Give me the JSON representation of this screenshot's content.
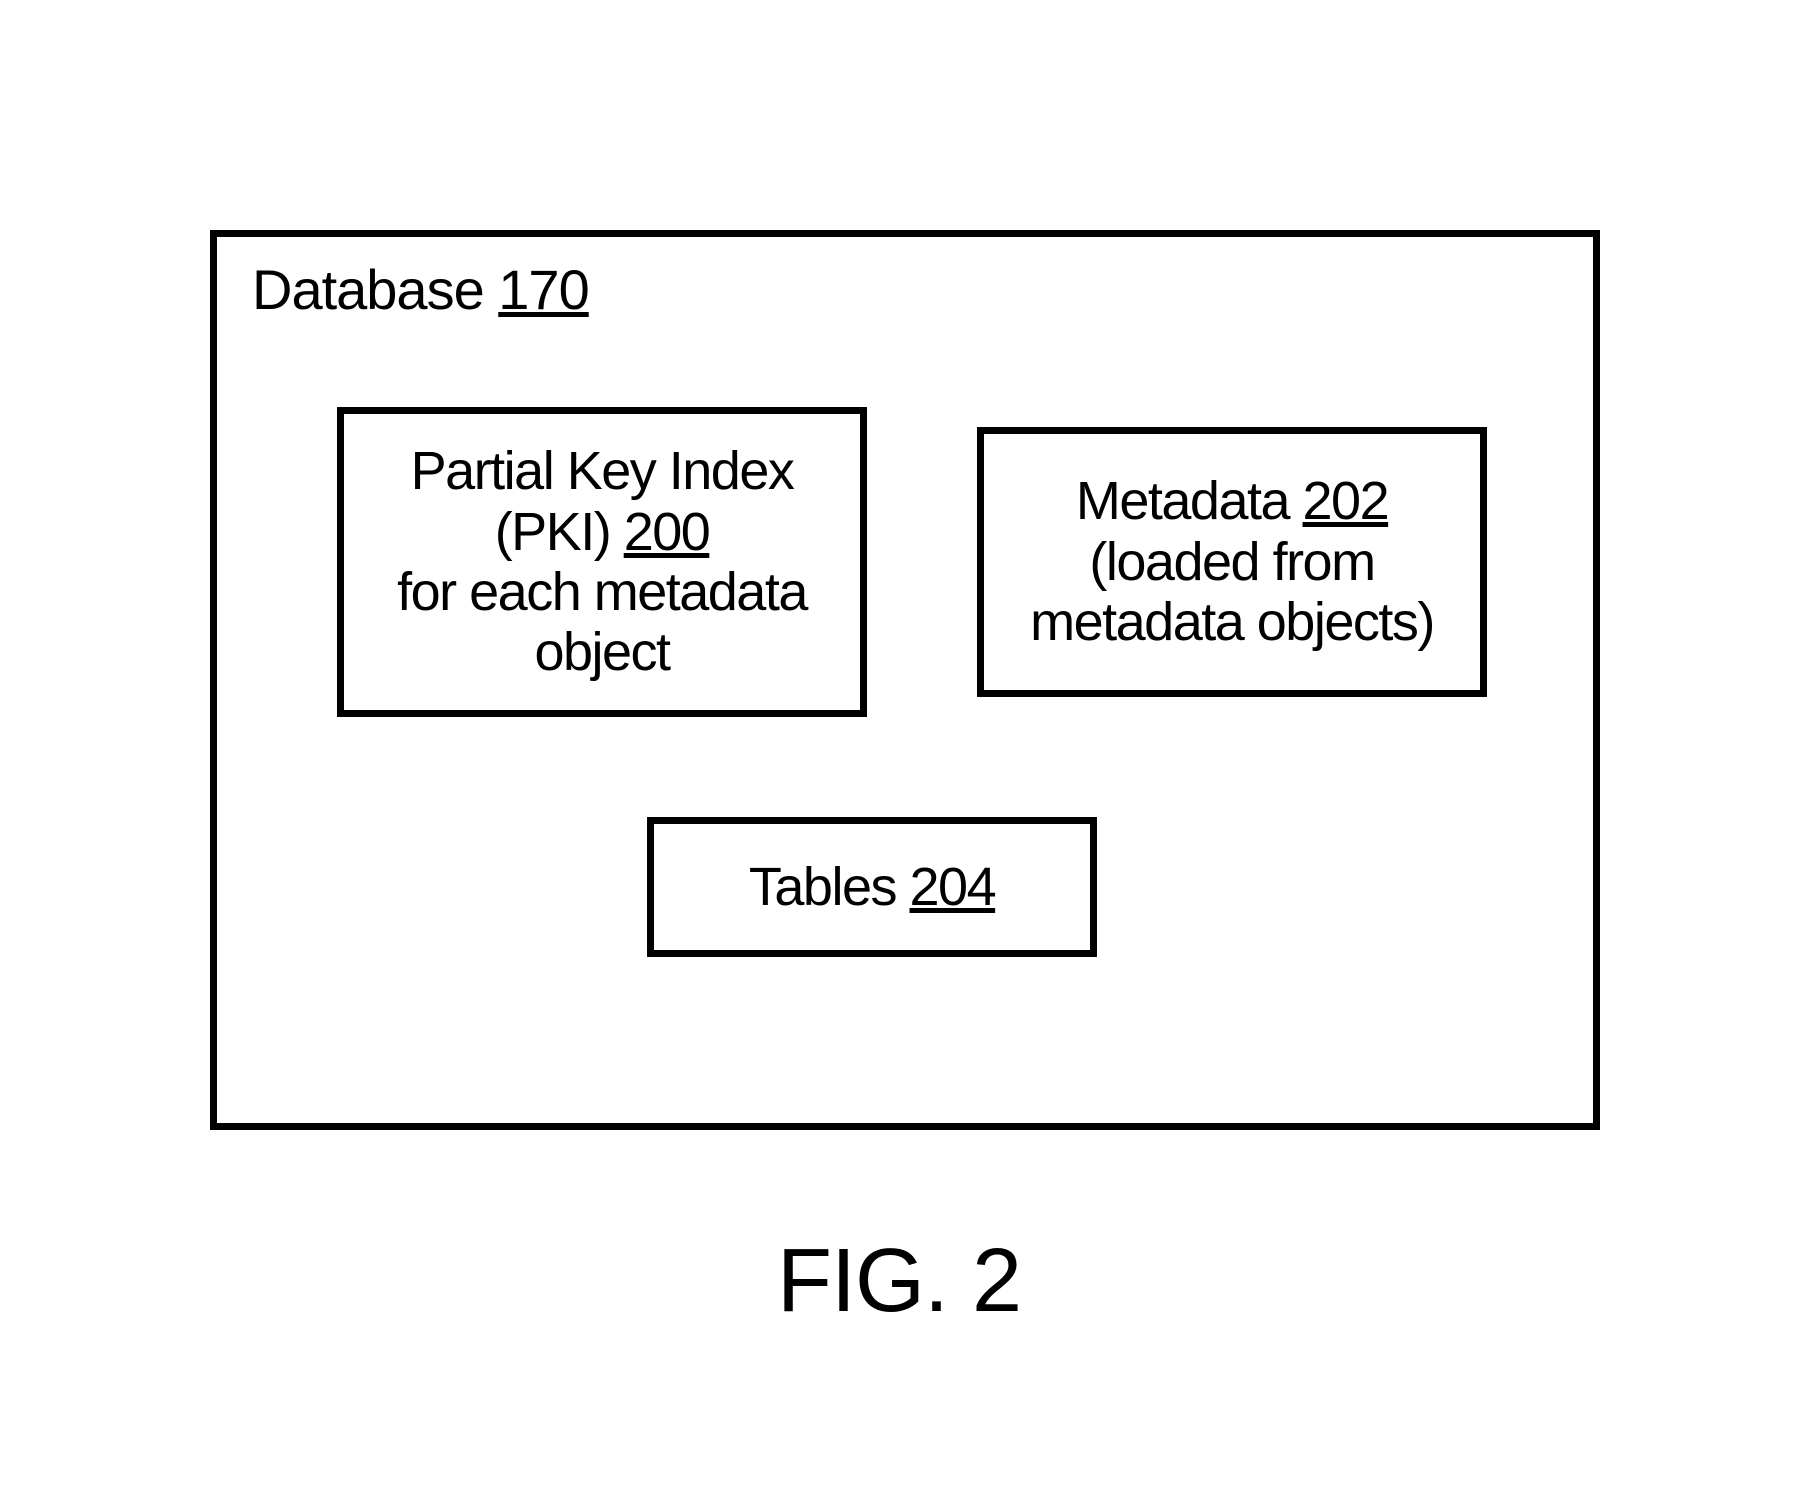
{
  "database": {
    "label_prefix": "Database ",
    "number": "170"
  },
  "pki": {
    "line1": "Partial Key Index",
    "line2_prefix": "(PKI) ",
    "number": "200",
    "line3": "for each metadata",
    "line4": "object"
  },
  "metadata": {
    "line1_prefix": "Metadata ",
    "number": "202",
    "line2": "(loaded from",
    "line3": "metadata objects)"
  },
  "tables": {
    "label_prefix": "Tables ",
    "number": "204"
  },
  "caption": "FIG. 2"
}
